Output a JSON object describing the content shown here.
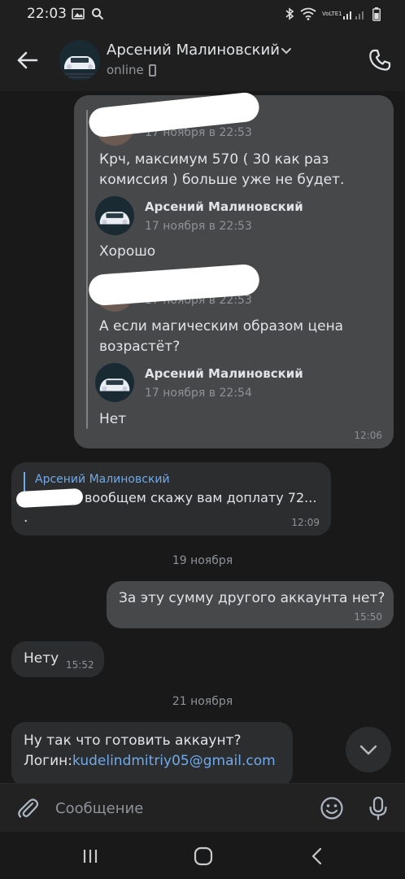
{
  "status_bar": {
    "time": "22:03",
    "network_label": "VoLTE1"
  },
  "header": {
    "name": "Арсений Малиновский",
    "status": "online",
    "icons": [
      "back-arrow-icon",
      "chevron-down-icon",
      "mobile-device-icon",
      "phone-icon"
    ]
  },
  "messages": {
    "forwarded_block": {
      "items": [
        {
          "author": "",
          "date": "17 ноября в 22:53",
          "text": "Крч, максимум 570 ( 30 как раз комиссия ) больше уже не будет."
        },
        {
          "author": "Арсений Малиновский",
          "date": "17 ноября в 22:53",
          "text": "Хорошо"
        },
        {
          "author": "",
          "date": "17 ноября в 22:53",
          "text": "А если магическим образом цена возрастёт?"
        },
        {
          "author": "Арсений Малиновский",
          "date": "17 ноября в 22:54",
          "text": "Нет"
        }
      ],
      "time": "12:06"
    },
    "reply_message": {
      "reply_author": "Арсений Малиновский",
      "reply_text": "вообщем скажу вам доплату 72...",
      "body_tail": ".",
      "time": "12:09"
    },
    "date_separators": [
      "19 ноября",
      "21 ноября"
    ],
    "outgoing_1": {
      "text": "За эту сумму другого аккаунта нет?",
      "time": "15:50"
    },
    "incoming_1": {
      "text": "Нету",
      "time": "15:52"
    },
    "incoming_2": {
      "line1": "Ну так что готовить аккаунт?",
      "line2_prefix": "Логин:",
      "line2_link": "kudelindmitriy05@gmail.com"
    }
  },
  "input_bar": {
    "placeholder": "Сообщение"
  },
  "colors": {
    "background": "#19191a",
    "bubble_out": "#474849",
    "bubble_in": "#2c2d2e",
    "link": "#71aaeb",
    "muted_text": "#8f9296"
  }
}
